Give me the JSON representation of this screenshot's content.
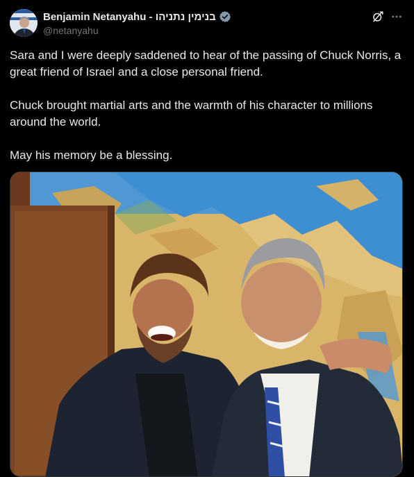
{
  "post": {
    "author": {
      "display_name": "Benjamin Netanyahu - בנימין נתניהו",
      "handle": "@netanyahu",
      "verified_badge": "verified-badge-icon"
    },
    "paragraphs": [
      "Sara and I were deeply saddened to hear of the passing of Chuck Norris, a great friend of Israel and a close personal friend.",
      "Chuck brought martial arts and the warmth of his character to millions around the world.",
      "May his memory be a blessing."
    ],
    "header_icons": [
      "grok-icon",
      "more-icon"
    ],
    "media": {
      "type": "photo"
    }
  },
  "colors": {
    "background": "#000000",
    "text_primary": "#e7e9ea",
    "text_secondary": "#71767b",
    "verified_badge": "#829aab"
  }
}
